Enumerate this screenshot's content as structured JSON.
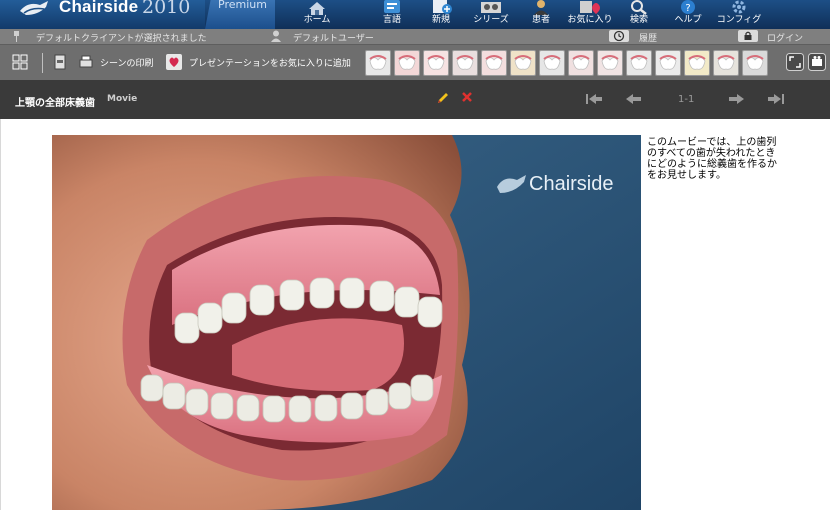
{
  "app": {
    "name": "Chairside",
    "year": "2010",
    "edition": "Premium"
  },
  "nav": [
    {
      "label": "ホーム",
      "icon": "home-icon"
    },
    {
      "label": "言語",
      "icon": "language-icon"
    },
    {
      "label": "新規",
      "icon": "new-icon"
    },
    {
      "label": "シリーズ",
      "icon": "series-icon"
    },
    {
      "label": "患者",
      "icon": "patient-icon"
    },
    {
      "label": "お気に入り",
      "icon": "favorites-icon"
    },
    {
      "label": "検索",
      "icon": "search-icon"
    },
    {
      "label": "ヘルプ",
      "icon": "help-icon"
    },
    {
      "label": "コンフィグ",
      "icon": "config-icon"
    }
  ],
  "status": {
    "client": "デフォルトクライアントが選択されました",
    "user": "デフォルトユーザー",
    "history": "履歴",
    "login": "ログイン"
  },
  "toolbar": {
    "print_label": "シーンの印刷",
    "favorite_label": "プレゼンテーションをお気に入りに追加"
  },
  "scene": {
    "title": "上顎の全部床義歯",
    "tag": "Movie",
    "pagination": "1-1",
    "description": "このムービーでは、上の歯列のすべての歯が失われたときにどのように総義歯を作るかをお見せします。",
    "watermark": "Chairside"
  },
  "colors": {
    "accent": "#1d4f86",
    "toolbar": "#6e6e6e",
    "titlebar": "#3a3a3a",
    "video_bg": "#2a5275"
  }
}
